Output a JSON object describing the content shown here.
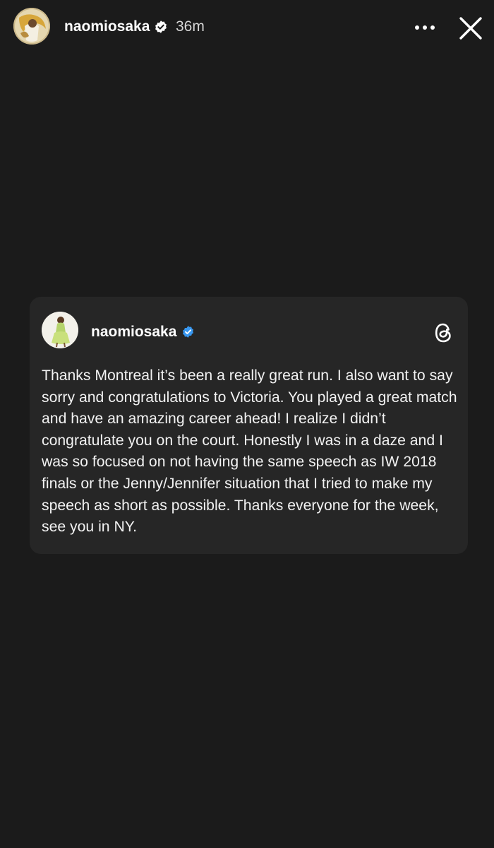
{
  "story_header": {
    "username": "naomiosaka",
    "time_ago": "36m",
    "avatar_icon": "profile-avatar",
    "verified_icon": "verified-badge-icon",
    "more_icon": "more-options-icon",
    "close_icon": "close-icon"
  },
  "threads_card": {
    "username": "naomiosaka",
    "verified_icon": "verified-badge-icon",
    "app_icon": "threads-logo-icon",
    "post_text": "Thanks Montreal it’s been a really great run. I also want to say sorry and congratulations to Victoria. You played a great match and have an amazing career ahead! I realize I didn’t congratulate you on the court. Honestly I was in a daze and I was so focused on not having the same speech as IW 2018 finals or the Jenny/Jennifer situation that I tried to make my speech as short as possible. Thanks everyone for the week, see you in NY."
  },
  "colors": {
    "background": "#1b1b1b",
    "card": "#262626",
    "verified_blue": "#3897f0",
    "text": "#ffffff"
  }
}
